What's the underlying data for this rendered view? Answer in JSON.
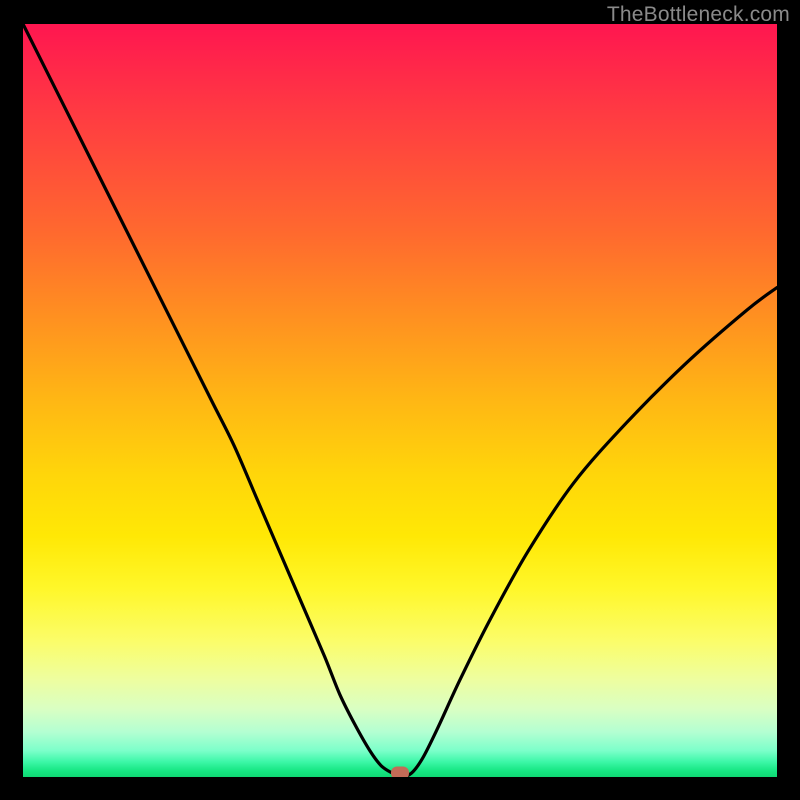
{
  "watermark": "TheBottleneck.com",
  "colors": {
    "watermark": "#8a8a8a",
    "frame": "#000000",
    "curve": "#000000",
    "marker": "#c36b57"
  },
  "chart_data": {
    "type": "line",
    "title": "",
    "xlabel": "",
    "ylabel": "",
    "xlim": [
      0,
      100
    ],
    "ylim": [
      0,
      100
    ],
    "grid": false,
    "legend": false,
    "annotations": [],
    "series": [
      {
        "name": "bottleneck-curve",
        "x": [
          0,
          5,
          10,
          15,
          20,
          25,
          28,
          31,
          34,
          37,
          40,
          42,
          44,
          46,
          47.5,
          49,
          50,
          51.5,
          53,
          55,
          58,
          62,
          67,
          73,
          80,
          88,
          96,
          100
        ],
        "values": [
          100,
          90,
          80,
          70,
          60,
          50,
          44,
          37,
          30,
          23,
          16,
          11,
          7,
          3.5,
          1.5,
          0.5,
          0,
          0.5,
          2.5,
          6.5,
          13,
          21,
          30,
          39,
          47,
          55,
          62,
          65
        ]
      }
    ],
    "marker": {
      "x": 50,
      "y": 0
    }
  }
}
